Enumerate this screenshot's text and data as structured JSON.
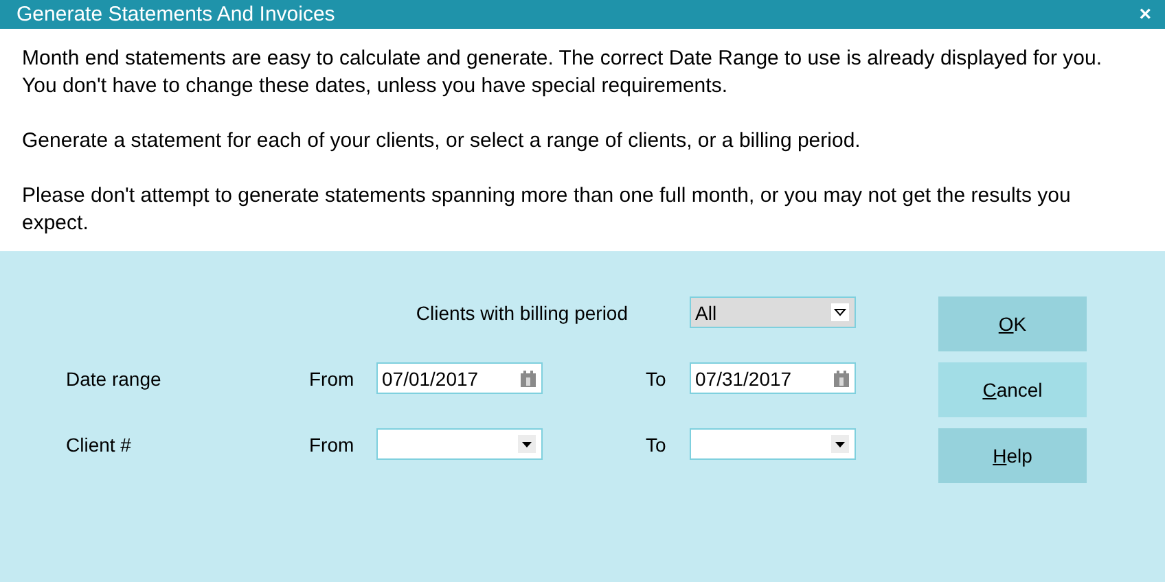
{
  "window": {
    "title": "Generate Statements And Invoices",
    "close": "×"
  },
  "intro": [
    "Month end statements are easy to calculate and generate. The correct Date Range to use is already displayed for you. You don't have to change these dates, unless you have special requirements.",
    "Generate a statement for each of your clients, or select a range of clients, or a billing period.",
    "Please don't attempt to generate statements spanning more than one full month, or you may not get the results you expect."
  ],
  "billing_period": {
    "label": "Clients with billing period",
    "value": "All"
  },
  "rows": [
    {
      "label": "Date range",
      "from_label": "From",
      "from": {
        "kind": "date",
        "value": "07/01/2017"
      },
      "to_label": "To",
      "to": {
        "kind": "date",
        "value": "07/31/2017"
      }
    },
    {
      "label": "Client #",
      "from_label": "From",
      "from": {
        "kind": "combo"
      },
      "to_label": "To",
      "to": {
        "kind": "combo"
      }
    }
  ],
  "buttons": [
    {
      "label": "OK",
      "accelerator_underlined": true,
      "focused": false
    },
    {
      "label": "Cancel",
      "accelerator_underlined": true,
      "focused": true
    },
    {
      "label": "Help",
      "accelerator_underlined": true,
      "focused": false
    }
  ]
}
